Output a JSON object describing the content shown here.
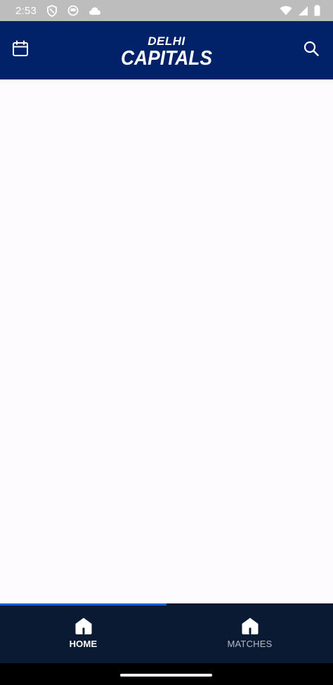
{
  "status_bar": {
    "time": "2:53",
    "left_icons": [
      "vpn-shield-icon",
      "app-notification-icon",
      "cloud-icon"
    ],
    "right_icons": [
      "wifi-icon",
      "signal-icon",
      "battery-icon"
    ]
  },
  "header": {
    "logo_line1": "DELHI",
    "logo_line2": "CAPITALS",
    "left_icon": "calendar-icon",
    "right_icon": "search-icon",
    "background": "#012269"
  },
  "bottom_nav": {
    "items": [
      {
        "label": "HOME",
        "icon": "home-icon",
        "active": true
      },
      {
        "label": "MATCHES",
        "icon": "home-icon",
        "active": false
      }
    ],
    "background": "#0b1a33",
    "indicator_color": "#1c5fd6"
  }
}
